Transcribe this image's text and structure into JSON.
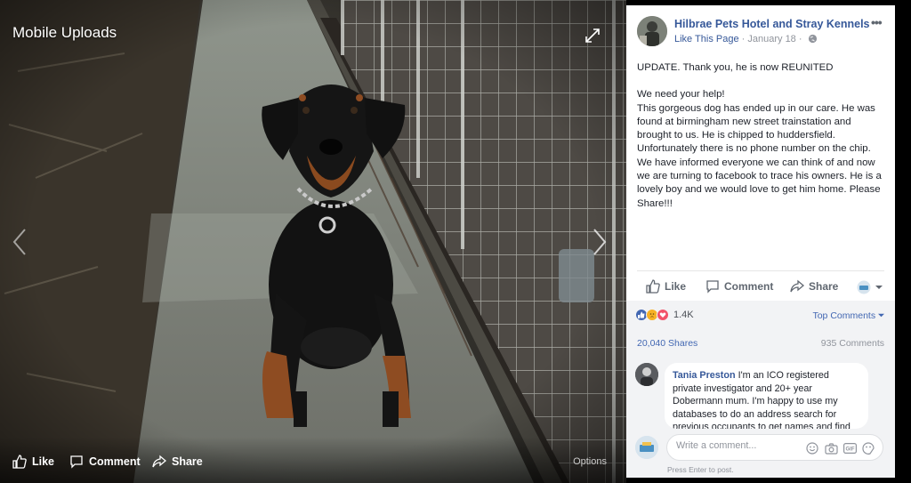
{
  "viewer": {
    "album_title": "Mobile Uploads",
    "actions": {
      "like": "Like",
      "comment": "Comment",
      "share": "Share",
      "options": "Options"
    },
    "icons": {
      "expand": "expand-icon",
      "prev": "chevron-left-icon",
      "next": "chevron-right-icon"
    }
  },
  "post": {
    "page_name": "Hilbrae Pets Hotel and Stray Kennels",
    "more": "•••",
    "like_page": "Like This Page",
    "separator": "·",
    "date": "January 18",
    "separator2": "·",
    "update_text": "UPDATE. Thank you, he is now REUNITED",
    "body_text": "We need your help!\nThis gorgeous dog has ended up in our care. He was found at birmingham new street trainstation and brought to us. He is chipped to huddersfield. Unfortunately there is no phone number on the chip. We have informed everyone we can think of and now we are turning to facebook to trace his owners. He is a lovely boy and we would love to get him home. Please Share!!!"
  },
  "actions": {
    "like": "Like",
    "comment": "Comment",
    "share": "Share"
  },
  "engagement": {
    "reaction_count": "1.4K",
    "top_comments": "Top Comments",
    "shares": "20,040 Shares",
    "comments": "935 Comments"
  },
  "comment": {
    "author": "Tania Preston",
    "text": "I'm an ICO registered private investigator and 20+ year Dobermann mum. I'm happy to use my databases to do an address search for previous occupants to get names and find"
  },
  "composer": {
    "placeholder": "Write a comment...",
    "hint": "Press Enter to post."
  },
  "colors": {
    "link": "#365899",
    "like_blue": "#4267b2",
    "love_red": "#f25268",
    "haha_yellow": "#f7b125"
  }
}
